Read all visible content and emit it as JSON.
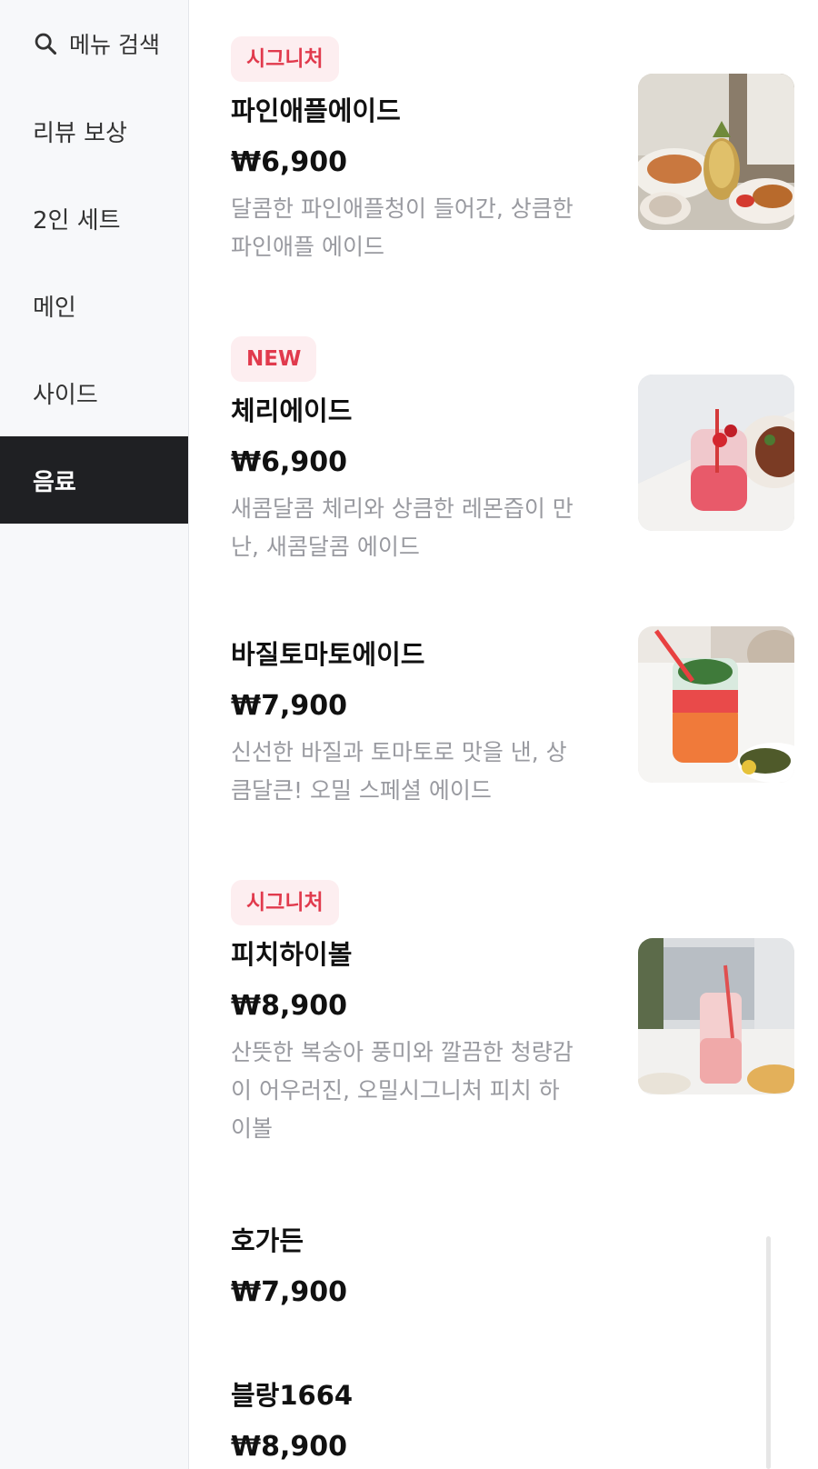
{
  "sidebar": {
    "search_label": "메뉴 검색",
    "items": [
      {
        "label": "리뷰 보상"
      },
      {
        "label": "2인 세트"
      },
      {
        "label": "메인"
      },
      {
        "label": "사이드"
      },
      {
        "label": "음료"
      }
    ],
    "active": "음료"
  },
  "menu": [
    {
      "badge": "시그니처",
      "name": "파인애플에이드",
      "price": "₩6,900",
      "desc": "달콤한 파인애플청이 들어간, 상큼한 파인애플 에이드",
      "image": "pineapple-ade-photo"
    },
    {
      "badge": "NEW",
      "name": "체리에이드",
      "price": "₩6,900",
      "desc": "새콤달콤 체리와 상큼한 레몬즙이 만난, 새콤달콤 에이드",
      "image": "cherry-ade-photo"
    },
    {
      "badge": "",
      "name": "바질토마토에이드",
      "price": "₩7,900",
      "desc": "신선한 바질과 토마토로 맛을 낸, 상큼달큰! 오밀 스페셜 에이드",
      "image": "basil-tomato-ade-photo"
    },
    {
      "badge": "시그니처",
      "name": "피치하이볼",
      "price": "₩8,900",
      "desc": "산뜻한 복숭아 풍미와 깔끔한 청량감이 어우러진, 오밀시그니처 피치 하이볼",
      "image": "peach-highball-photo"
    },
    {
      "badge": "",
      "name": "호가든",
      "price": "₩7,900"
    },
    {
      "badge": "",
      "name": "블랑1664",
      "price": "₩8,900"
    }
  ],
  "colors": {
    "accent": "#e13a4d",
    "badge_bg": "#fdeef0",
    "active_bg": "#1f2023",
    "sidebar_bg": "#f7f8fa"
  }
}
